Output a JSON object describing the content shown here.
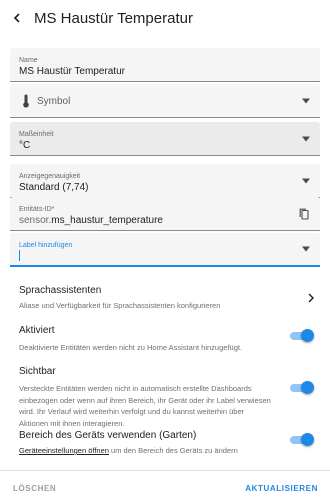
{
  "header": {
    "title": "MS Haustür Temperatur"
  },
  "fields": {
    "name": {
      "label": "Name",
      "value": "MS Haustür Temperatur"
    },
    "icon": {
      "placeholder": "Symbol"
    },
    "unit": {
      "label": "Maßeinheit",
      "value": "°C"
    },
    "precision": {
      "label": "Anzeigegenauigkeit",
      "value": "Standard (7,74)"
    },
    "entity_id": {
      "label": "Entitäts-ID*",
      "prefix": "sensor.",
      "value": "ms_haustur_temperature"
    },
    "labels": {
      "label": "Label hinzufügen"
    }
  },
  "rows": {
    "voice": {
      "title": "Sprachassistenten",
      "desc": "Aliase und Verfügbarkeit für Sprachassistenten konfigurieren"
    },
    "active": {
      "title": "Aktiviert",
      "desc": "Deaktivierte Entitäten werden nicht zu Home Assistant hinzugefügt.",
      "on": true
    },
    "visible": {
      "title": "Sichtbar",
      "desc": "Versteckte Entitäten werden nicht in automatisch erstellte Dashboards einbezogen oder wenn auf ihren Bereich, ihr Gerät oder ihr Label verwiesen wird. Ihr Verlauf wird weiterhin verfolgt und du kannst weiterhin über Aktionen mit ihnen interagieren.",
      "on": true
    },
    "area": {
      "title": "Bereich des Geräts verwenden (Garten)",
      "link": "Geräteeinstellungen öffnen",
      "desc_rest": " um den Bereich des Geräts zu ändern",
      "on": true
    }
  },
  "footer": {
    "delete": "LÖSCHEN",
    "update": "AKTUALISIEREN"
  },
  "colors": {
    "accent": "#1e88e5",
    "toggle_track": "#90c6f5"
  }
}
